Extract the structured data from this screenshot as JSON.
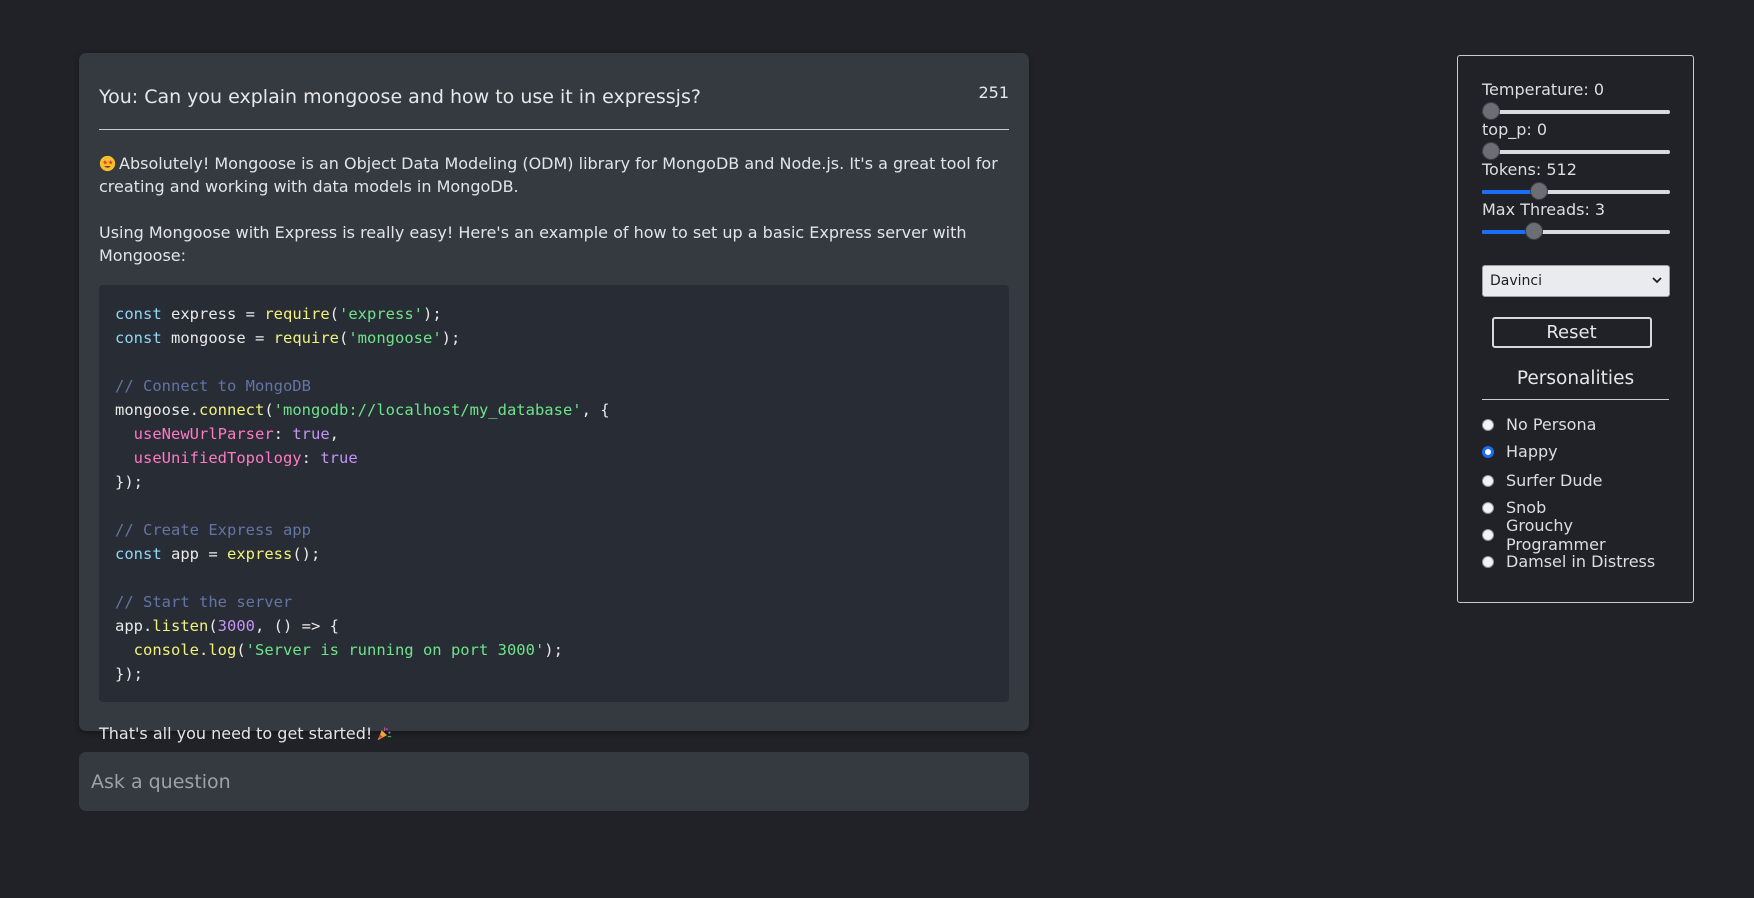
{
  "chat": {
    "question": "You: Can you explain mongoose and how to use it in expressjs?",
    "count": "251",
    "paragraph1": "Absolutely! Mongoose is an Object Data Modeling (ODM) library for MongoDB and Node.js. It's a great tool for creating and working with data models in MongoDB.",
    "paragraph2": "Using Mongoose with Express is really easy! Here's an example of how to set up a basic Express server with Mongoose:",
    "paragraph3": "That's all you need to get started!",
    "emoji_start": "star-struck-emoji",
    "emoji_end": "party-popper-emoji",
    "code_lines": [
      [
        {
          "t": "const",
          "c": "kw"
        },
        {
          "t": " express = "
        },
        {
          "t": "require",
          "c": "fn"
        },
        {
          "t": "("
        },
        {
          "t": "'express'",
          "c": "str"
        },
        {
          "t": ");"
        }
      ],
      [
        {
          "t": "const",
          "c": "kw"
        },
        {
          "t": " mongoose = "
        },
        {
          "t": "require",
          "c": "fn"
        },
        {
          "t": "("
        },
        {
          "t": "'mongoose'",
          "c": "str"
        },
        {
          "t": ");"
        }
      ],
      [],
      [
        {
          "t": "// Connect to MongoDB",
          "c": "cm"
        }
      ],
      [
        {
          "t": "mongoose."
        },
        {
          "t": "connect",
          "c": "fn"
        },
        {
          "t": "("
        },
        {
          "t": "'mongodb://localhost/my_database'",
          "c": "str"
        },
        {
          "t": ", {"
        }
      ],
      [
        {
          "t": "  "
        },
        {
          "t": "useNewUrlParser",
          "c": "prop"
        },
        {
          "t": ": "
        },
        {
          "t": "true",
          "c": "bool"
        },
        {
          "t": ","
        }
      ],
      [
        {
          "t": "  "
        },
        {
          "t": "useUnifiedTopology",
          "c": "prop"
        },
        {
          "t": ": "
        },
        {
          "t": "true",
          "c": "bool"
        }
      ],
      [
        {
          "t": "});"
        }
      ],
      [],
      [
        {
          "t": "// Create Express app",
          "c": "cm"
        }
      ],
      [
        {
          "t": "const",
          "c": "kw"
        },
        {
          "t": " app = "
        },
        {
          "t": "express",
          "c": "fn"
        },
        {
          "t": "();"
        }
      ],
      [],
      [
        {
          "t": "// Start the server",
          "c": "cm"
        }
      ],
      [
        {
          "t": "app."
        },
        {
          "t": "listen",
          "c": "fn"
        },
        {
          "t": "("
        },
        {
          "t": "3000",
          "c": "num"
        },
        {
          "t": ", () => {"
        }
      ],
      [
        {
          "t": "  "
        },
        {
          "t": "console.log",
          "c": "fn"
        },
        {
          "t": "("
        },
        {
          "t": "'Server is running on port 3000'",
          "c": "str"
        },
        {
          "t": ");"
        }
      ],
      [
        {
          "t": "});"
        }
      ]
    ]
  },
  "input": {
    "placeholder": "Ask a question"
  },
  "settings": {
    "temperature": {
      "label": "Temperature: 0",
      "fraction": 0
    },
    "top_p": {
      "label": "top_p: 0",
      "fraction": 0
    },
    "tokens": {
      "label": "Tokens: 512",
      "fraction": 0.28
    },
    "max_threads": {
      "label": "Max Threads: 3",
      "fraction": 0.25
    },
    "model": "Davinci",
    "reset_label": "Reset"
  },
  "personalities": {
    "title": "Personalities",
    "options": [
      {
        "label": "No Persona",
        "checked": false
      },
      {
        "label": "Happy",
        "checked": true
      },
      {
        "label": "Surfer Dude",
        "checked": false
      },
      {
        "label": "Snob",
        "checked": false
      },
      {
        "label": "Grouchy Programmer",
        "checked": false
      },
      {
        "label": "Damsel in Distress",
        "checked": false
      }
    ]
  },
  "colors": {
    "background": "#202227",
    "card": "#343a40",
    "accent": "#1a6ef5"
  }
}
